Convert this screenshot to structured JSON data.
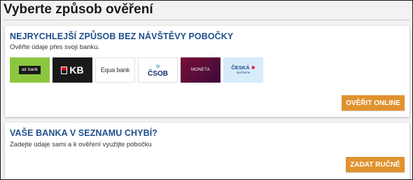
{
  "page": {
    "title": "Vyberte způsob ověření"
  },
  "online": {
    "heading": "NEJRYCHLEJŠÍ ZPŮSOB BEZ NÁVŠTĚVY POBOČKY",
    "subtitle": "Ověřte údaje přes svoji banku.",
    "banks": [
      {
        "name": "air bank",
        "icon": "air-bank-logo"
      },
      {
        "name": "KB",
        "icon": "kb-logo"
      },
      {
        "name": "Equa bank",
        "icon": "equa-bank-logo"
      },
      {
        "name": "ČSOB",
        "icon": "csob-logo"
      },
      {
        "name": "MONETA",
        "icon": "moneta-logo"
      },
      {
        "name": "ČESKÁ",
        "sub": "spořitelna",
        "icon": "ceska-sporitelna-logo"
      }
    ],
    "button_label": "OVĚŘIT ONLINE"
  },
  "manual": {
    "heading": "VAŠE BANKA V SEZNAMU CHYBÍ?",
    "subtitle": "Zadejte údaje sami a k ověření využijte pobočku",
    "button_label": "ZADAT RUČNĚ"
  },
  "colors": {
    "heading": "#1f4e8c",
    "button": "#e0922e",
    "air_bank_green": "#8cc63f",
    "kb_red": "#e2001a",
    "cs_light_blue": "#d7ecfb"
  }
}
